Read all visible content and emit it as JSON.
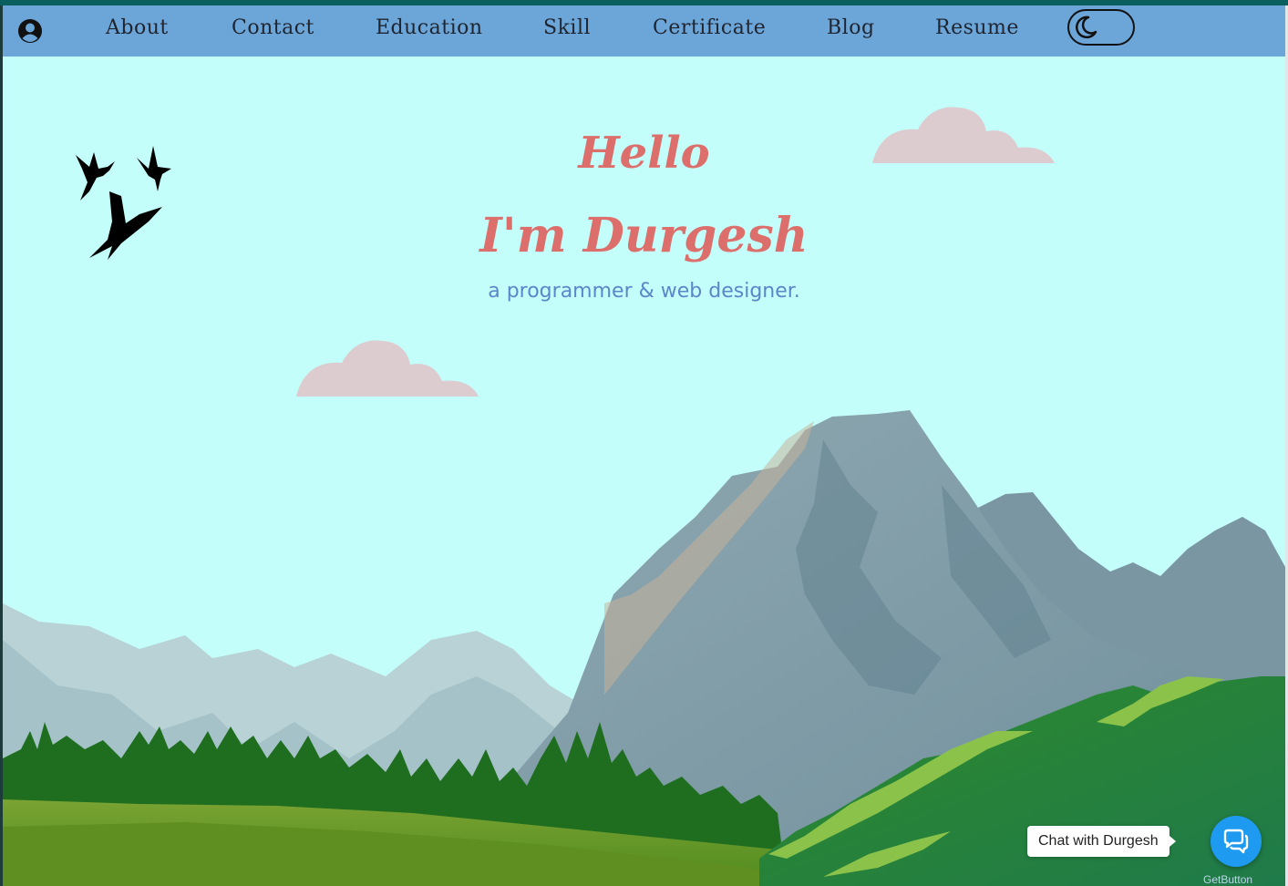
{
  "nav": {
    "items": [
      {
        "label": "About"
      },
      {
        "label": "Contact"
      },
      {
        "label": "Education"
      },
      {
        "label": "Skill"
      },
      {
        "label": "Certificate"
      },
      {
        "label": "Blog"
      },
      {
        "label": "Resume"
      }
    ],
    "user_icon": "user-circle-icon",
    "theme_toggle_icon": "moon-icon"
  },
  "hero": {
    "greeting": "Hello",
    "name": "I'm Durgesh",
    "tagline": "a programmer & web designer."
  },
  "chat": {
    "label": "Chat with Durgesh",
    "icon": "chat-bubbles-icon",
    "brand": "GetButton"
  },
  "colors": {
    "nav_bg": "#6ca6d8",
    "sky": "#c4fefa",
    "heading": "#dc6f6b",
    "tagline": "#5b86c9",
    "cloud": "#dccbcf",
    "chat_button": "#1e9bf0"
  }
}
